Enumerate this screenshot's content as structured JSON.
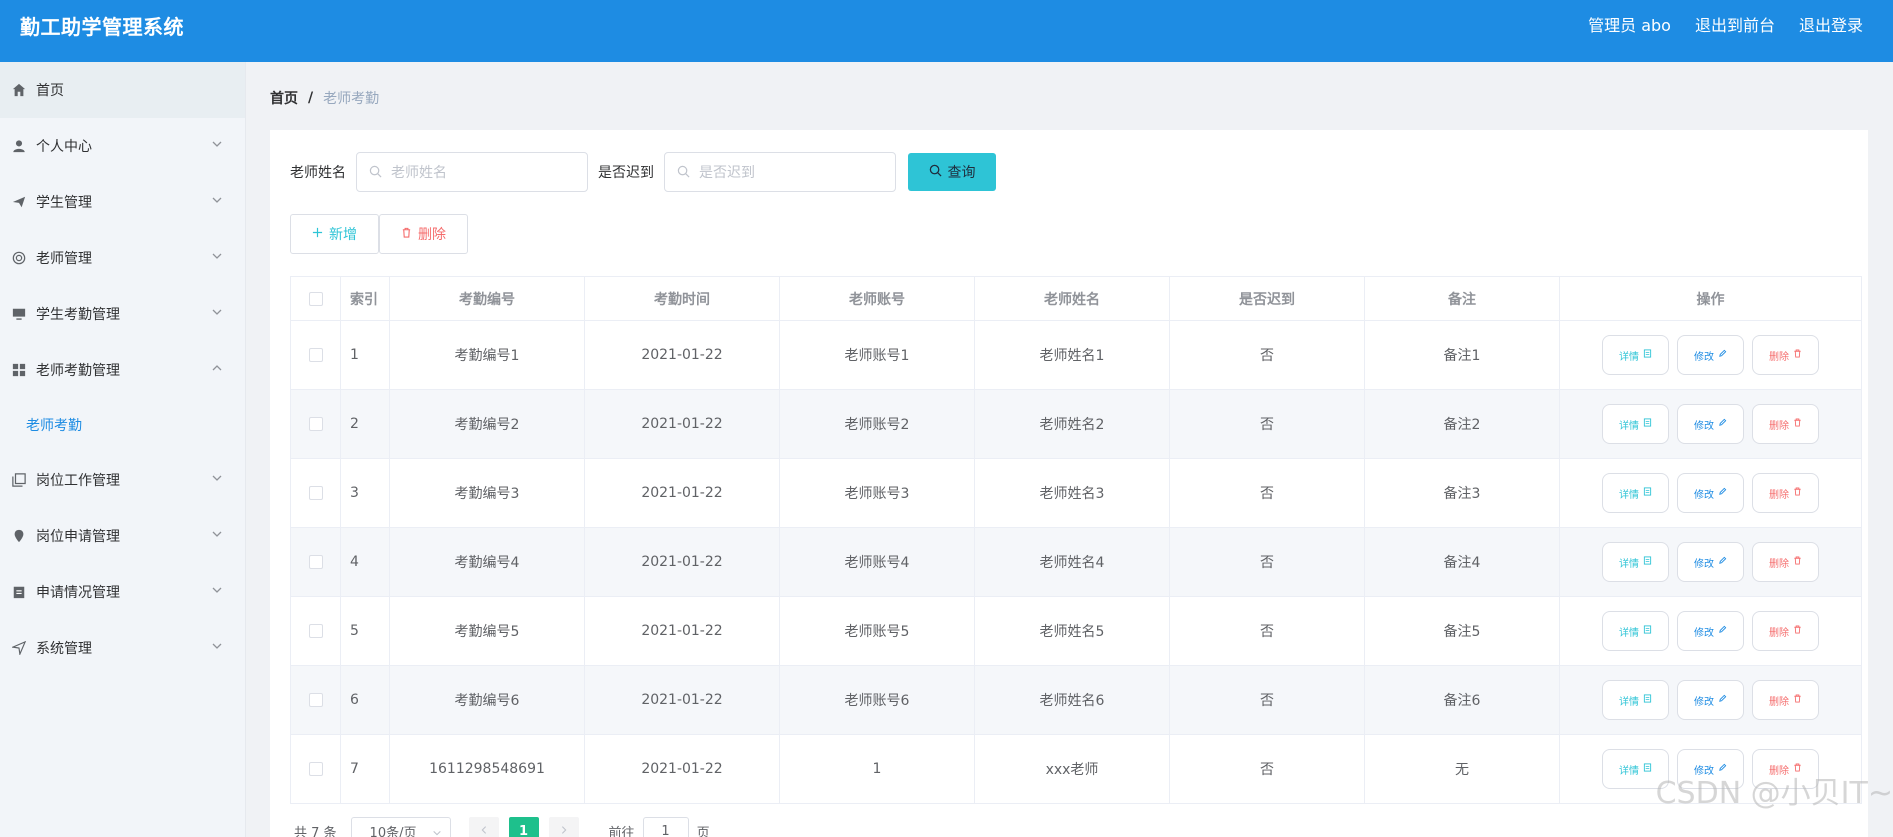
{
  "header": {
    "title": "勤工助学管理系统",
    "user": "管理员 abo",
    "to_front": "退出到前台",
    "logout": "退出登录"
  },
  "sidebar": {
    "items": [
      {
        "label": "首页",
        "icon": "home-icon",
        "has_chevron": false
      },
      {
        "label": "个人中心",
        "icon": "user-icon",
        "has_chevron": true
      },
      {
        "label": "学生管理",
        "icon": "send-icon",
        "has_chevron": true
      },
      {
        "label": "老师管理",
        "icon": "help-circle-icon",
        "has_chevron": true
      },
      {
        "label": "学生考勤管理",
        "icon": "monitor-icon",
        "has_chevron": true
      },
      {
        "label": "老师考勤管理",
        "icon": "grid-icon",
        "has_chevron": true,
        "expanded": true
      },
      {
        "label": "岗位工作管理",
        "icon": "copy-icon",
        "has_chevron": true
      },
      {
        "label": "岗位申请管理",
        "icon": "location-icon",
        "has_chevron": true
      },
      {
        "label": "申请情况管理",
        "icon": "clipboard-icon",
        "has_chevron": true
      },
      {
        "label": "系统管理",
        "icon": "navigation-icon",
        "has_chevron": true
      }
    ],
    "sub_item": "老师考勤"
  },
  "breadcrumb": {
    "home": "首页",
    "separator": "/",
    "current": "老师考勤"
  },
  "search": {
    "name_label": "老师姓名",
    "name_placeholder": "老师姓名",
    "late_label": "是否迟到",
    "late_placeholder": "是否迟到",
    "query_button": "查询"
  },
  "actions": {
    "add": "新增",
    "delete": "删除"
  },
  "table": {
    "headers": [
      "索引",
      "考勤编号",
      "考勤时间",
      "老师账号",
      "老师姓名",
      "是否迟到",
      "备注",
      "操作"
    ],
    "rows": [
      [
        "1",
        "考勤编号1",
        "2021-01-22",
        "老师账号1",
        "老师姓名1",
        "否",
        "备注1"
      ],
      [
        "2",
        "考勤编号2",
        "2021-01-22",
        "老师账号2",
        "老师姓名2",
        "否",
        "备注2"
      ],
      [
        "3",
        "考勤编号3",
        "2021-01-22",
        "老师账号3",
        "老师姓名3",
        "否",
        "备注3"
      ],
      [
        "4",
        "考勤编号4",
        "2021-01-22",
        "老师账号4",
        "老师姓名4",
        "否",
        "备注4"
      ],
      [
        "5",
        "考勤编号5",
        "2021-01-22",
        "老师账号5",
        "老师姓名5",
        "否",
        "备注5"
      ],
      [
        "6",
        "考勤编号6",
        "2021-01-22",
        "老师账号6",
        "老师姓名6",
        "否",
        "备注6"
      ],
      [
        "7",
        "1611298548691",
        "2021-01-22",
        "1",
        "xxx老师",
        "否",
        "无"
      ]
    ],
    "op_labels": {
      "detail": "详情",
      "edit": "修改",
      "delete": "删除"
    }
  },
  "pagination": {
    "total": "共 7 条",
    "page_size": "10条/页",
    "current_page": "1",
    "goto_prefix": "前往",
    "goto_value": "1",
    "goto_suffix": "页"
  },
  "watermark": "CSDN @小贝IT~",
  "colors": {
    "header_bg": "#1e8ce3",
    "accent_cyan": "#2ec4d6",
    "danger": "#f56c6c",
    "page_active": "#1ec08c"
  }
}
